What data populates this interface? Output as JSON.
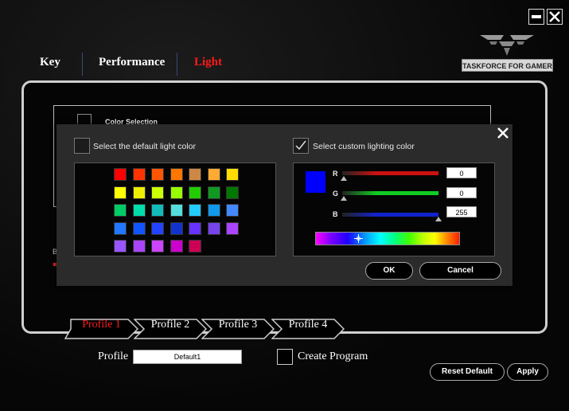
{
  "window": {
    "minimize_icon": "minimize-icon",
    "close_icon": "close-icon"
  },
  "logo": {
    "text": "TASKFORCE FOR GAMER",
    "icon": "logo-icon"
  },
  "tabs": [
    {
      "label": "Key",
      "active": false
    },
    {
      "label": "Performance",
      "active": false
    },
    {
      "label": "Light",
      "active": true
    }
  ],
  "color_selection_label": "Color Selection",
  "background_letter": "B",
  "dialog": {
    "default_label": "Select the default light color",
    "custom_label": "Select custom lighting color",
    "default_checked": false,
    "custom_checked": true,
    "palette": [
      [
        "#ff0000",
        "#ff3300",
        "#ff5500",
        "#ff7700",
        "#cc8844",
        "#ffaa33",
        "#ffdd00"
      ],
      [
        "#ffff00",
        "#eeee00",
        "#ccff00",
        "#99ff00",
        "#22cc00",
        "#119922",
        "#007700"
      ],
      [
        "#00cc66",
        "#00ddaa",
        "#11bbbb",
        "#55dddd",
        "#22ccff",
        "#1199ee",
        "#4488ff"
      ],
      [
        "#2277ff",
        "#1155ff",
        "#2244ff",
        "#1133cc",
        "#6633ff",
        "#7744ee",
        "#aa44ff"
      ],
      [
        "#9955ff",
        "#aa44ff",
        "#cc44ff",
        "#cc00cc",
        "#cc0055"
      ]
    ],
    "preview_color": "#0000ff",
    "channels": [
      {
        "label": "R",
        "value": "0",
        "color": "#cc1111"
      },
      {
        "label": "G",
        "value": "0",
        "color": "#11cc22"
      },
      {
        "label": "B",
        "value": "255",
        "color": "#1122cc"
      }
    ],
    "ok_label": "OK",
    "cancel_label": "Cancel"
  },
  "profiles": [
    {
      "label": "Profile 1",
      "active": true
    },
    {
      "label": "Profile 2",
      "active": false
    },
    {
      "label": "Profile 3",
      "active": false
    },
    {
      "label": "Profile 4",
      "active": false
    }
  ],
  "profile_label": "Profile",
  "profile_name": "Default1",
  "create_program_label": "Create Program",
  "create_program_checked": false,
  "reset_default_label": "Reset Default",
  "apply_label": "Apply"
}
